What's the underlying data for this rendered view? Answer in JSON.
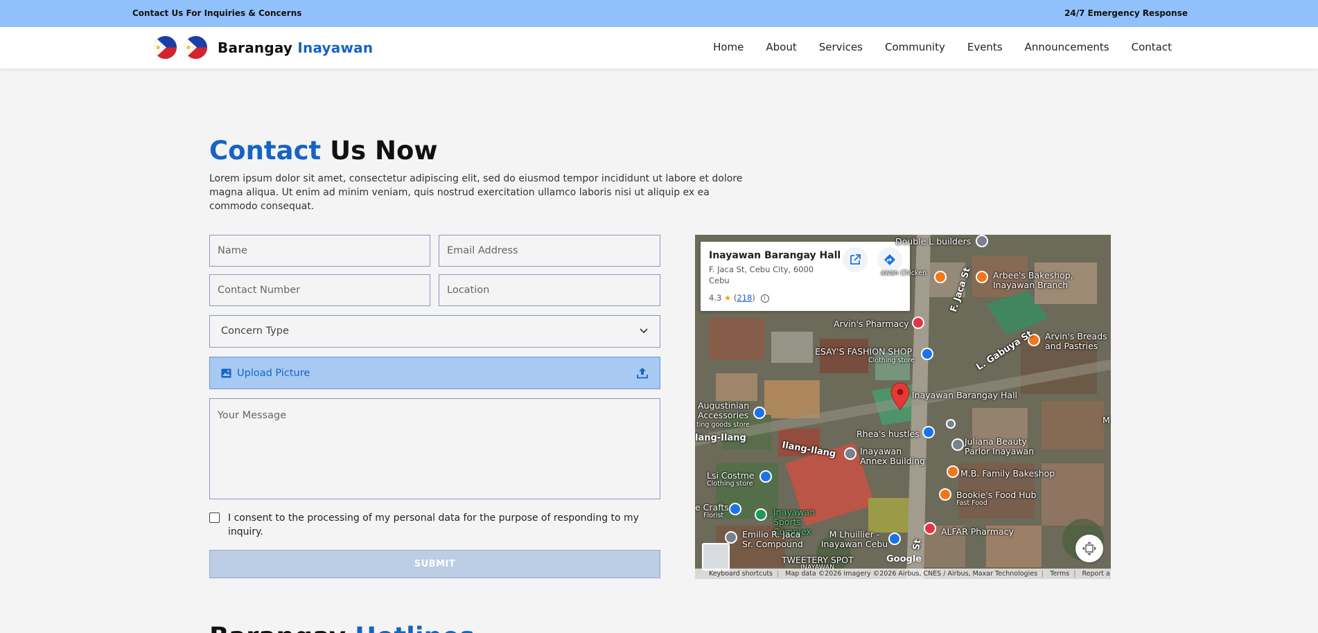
{
  "topbar": {
    "left_text": "Contact Us For Inquiries & Concerns",
    "right_text": "24/7 Emergency Response"
  },
  "brand": {
    "name": "Barangay",
    "name_accent": "Inayawan",
    "logo_icons": [
      "philippine-flag-icon",
      "philippine-flag-icon"
    ]
  },
  "nav": {
    "items": [
      "Home",
      "About",
      "Services",
      "Community",
      "Events",
      "Announcements",
      "Contact"
    ]
  },
  "page": {
    "heading_accent": "Contact",
    "heading_rest": "Us Now",
    "intro": "Lorem ipsum dolor sit amet, consectetur adipiscing elit, sed do eiusmod tempor incididunt ut labore et dolore magna aliqua. Ut enim ad minim veniam, quis nostrud exercitation ullamco laboris nisi ut aliquip ex ea commodo consequat."
  },
  "form": {
    "name_placeholder": "Name",
    "email_placeholder": "Email Address",
    "contact_placeholder": "Contact Number",
    "location_placeholder": "Location",
    "concern_label": "Concern Type",
    "upload_label": "Upload Picture",
    "message_placeholder": "Your Message",
    "consent_text": "I consent to the processing of my personal data for the purpose of responding to my inquiry.",
    "submit_label": "SUBMIT"
  },
  "map": {
    "place_name": "Inayawan Barangay Hall",
    "address": "F. Jaca St, Cebu City, 6000 Cebu",
    "rating": "4.3",
    "review_count": "218",
    "labels": {
      "builders": "Double L builders",
      "arbees": "Arbee's Bakeshop, Inayawan Branch",
      "arvins_pharmacy": "Arvin's Pharmacy",
      "esays": "ESAY'S FASHION SHOP",
      "clothing_store": "Clothing store",
      "arvins_breads": "Arvin's Breads and Pastries",
      "barangay_hall": "Inayawan Barangay Hall",
      "augustinian": "Augustinian Accessories",
      "sporting_goods": "ting goods store",
      "rheas": "Rhea's hustles",
      "juliana": "Juliana Beauty Parlor Inayawan",
      "annex": "Inayawan Annex Building",
      "lsi": "Lsi Costme",
      "lsi_sub": "Clothing store",
      "mb_family": "M.B. Family Bakeshop",
      "bookies": "Bookie's Food Hub",
      "fast_food": "Fast Food",
      "crafts": "e Crafts",
      "florist": "Florist",
      "sports_complex": "Inayawan Sports Complex",
      "emilio": "Emilio R. Jaca Sr. Compound",
      "m_lhuillier": "M Lhuillier - Inayawan Cebu",
      "alfar": "ALFAR Pharmacy",
      "tweetery": "TWEETERY SPOT",
      "inayawan_bottom": "INAYAWAN",
      "street_jaca": "F. Jaca St",
      "street_gabuya": "L. Gabuya St",
      "street_ilang": "Ilang-Ilang",
      "street_ilang2": "lang-Ilang",
      "street_st": "St",
      "awan_chicken": "awan Chicken",
      "google": "Google",
      "edge_m": "M"
    },
    "attribution": {
      "shortcuts": "Keyboard shortcuts",
      "map_data": "Map data ©2026 Imagery ©2026 Airbus, CNES / Airbus, Maxar Technologies",
      "terms": "Terms",
      "report": "Report a map error"
    }
  },
  "hotlines": {
    "title": "Barangay",
    "title_accent": "Hotlines"
  }
}
